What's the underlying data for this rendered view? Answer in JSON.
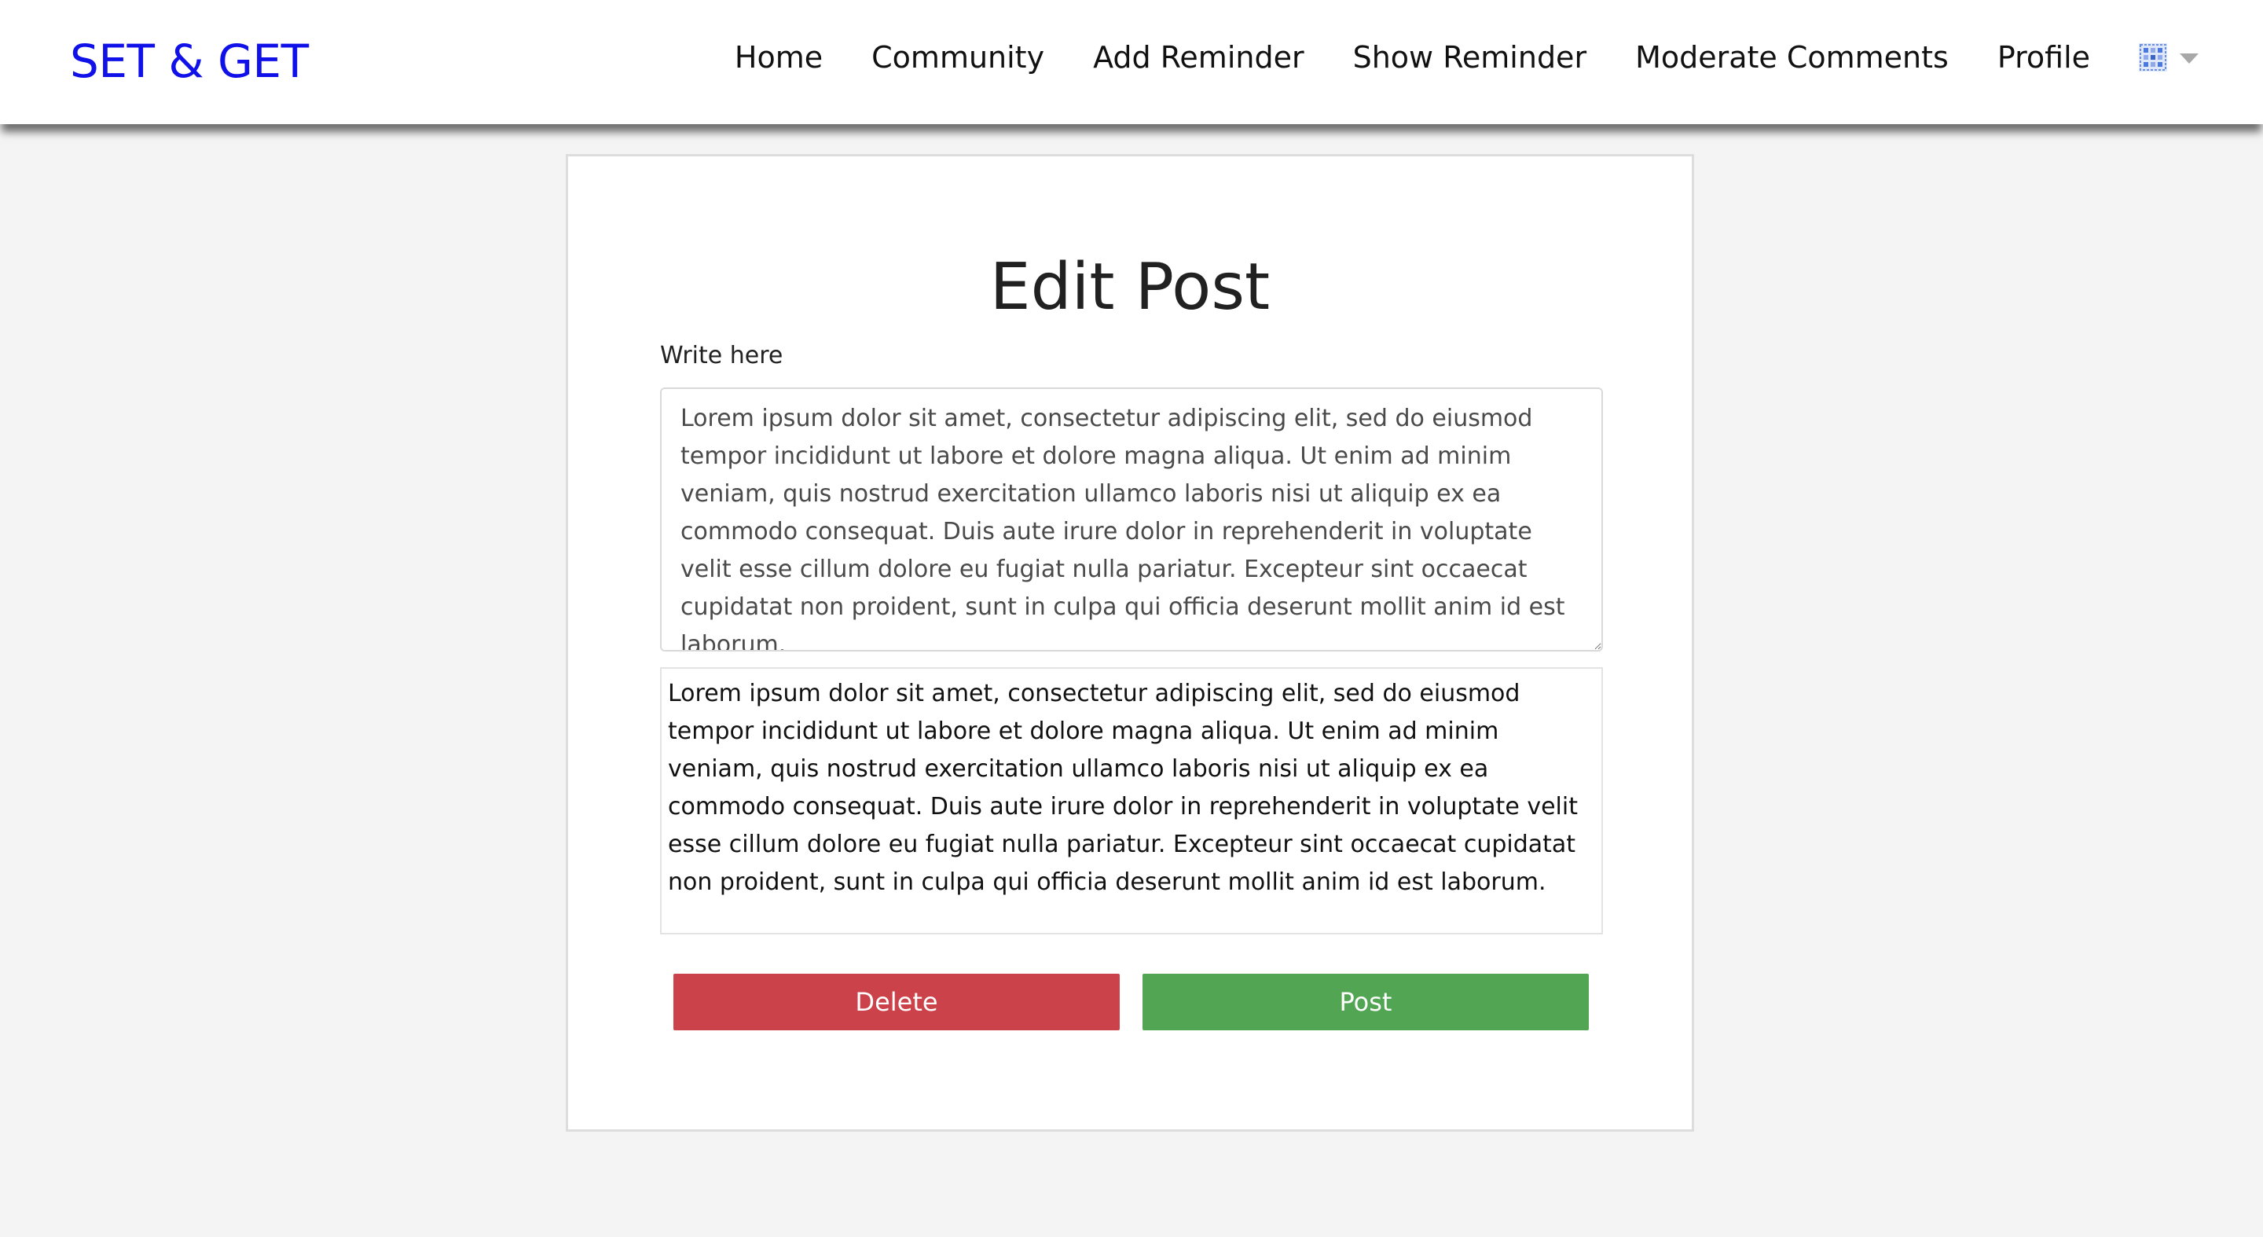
{
  "navbar": {
    "brand": "SET & GET",
    "links": [
      "Home",
      "Community",
      "Add Reminder",
      "Show Reminder",
      "Moderate Comments",
      "Profile"
    ],
    "language_icon": "flag-icon",
    "dropdown_icon": "caret-down-icon"
  },
  "editor": {
    "title": "Edit Post",
    "field_label": "Write here",
    "textarea_value": "Lorem ipsum dolor sit amet, consectetur adipiscing elit, sed do eiusmod tempor incididunt ut labore et dolore magna aliqua. Ut enim ad minim veniam, quis nostrud exercitation ullamco laboris nisi ut aliquip ex ea commodo consequat. Duis aute irure dolor in reprehenderit in voluptate velit esse cillum dolore eu fugiat nulla pariatur. Excepteur sint occaecat cupidatat non proident, sunt in culpa qui officia deserunt mollit anim id est laborum.",
    "preview_text": "Lorem ipsum dolor sit amet, consectetur adipiscing elit, sed do eiusmod tempor incididunt ut labore et dolore magna aliqua. Ut enim ad minim veniam, quis nostrud exercitation ullamco laboris nisi ut aliquip ex ea commodo consequat. Duis aute irure dolor in reprehenderit in voluptate velit esse cillum dolore eu fugiat nulla pariatur. Excepteur sint occaecat cupidatat non proident, sunt in culpa qui officia deserunt mollit anim id est laborum.",
    "delete_label": "Delete",
    "post_label": "Post"
  },
  "colors": {
    "brand": "#1010e8",
    "delete": "#cc424a",
    "post": "#51a553",
    "background": "#f4f4f4"
  }
}
